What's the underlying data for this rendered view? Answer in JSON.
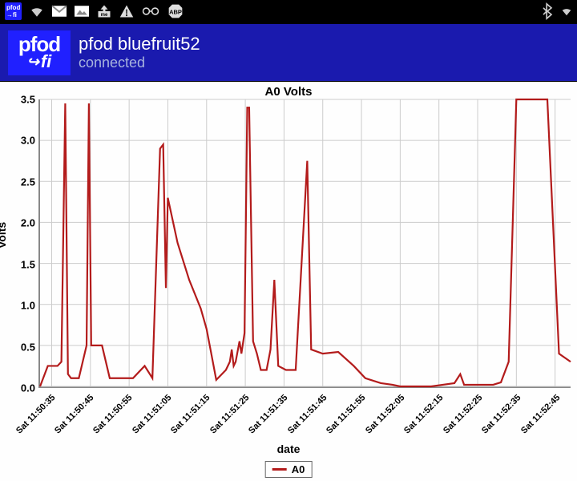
{
  "status_bar": {
    "left_icons": [
      "pfod-mini",
      "wifi",
      "gmail",
      "photos",
      "upload-me",
      "warning",
      "glasses",
      "abp"
    ],
    "right_icons": [
      "bluetooth",
      "wifi"
    ]
  },
  "header": {
    "logo": {
      "line1": "pfod",
      "line2": "fi"
    },
    "title": "pfod bluefruit52",
    "subtitle": "connected"
  },
  "chart_data": {
    "type": "line",
    "title": "A0 Volts",
    "ylabel": "Volts",
    "xlabel": "date",
    "ylim": [
      0.0,
      3.5
    ],
    "yticks": [
      0.0,
      0.5,
      1.0,
      1.5,
      2.0,
      2.5,
      3.0,
      3.5
    ],
    "categories": [
      "Sat 11:50:35",
      "Sat 11:50:45",
      "Sat 11:50:55",
      "Sat 11:51:05",
      "Sat 11:51:15",
      "Sat 11:51:25",
      "Sat 11:51:35",
      "Sat 11:51:45",
      "Sat 11:51:55",
      "Sat 11:52:05",
      "Sat 11:52:15",
      "Sat 11:52:25",
      "Sat 11:52:35",
      "Sat 11:52:45"
    ],
    "series": [
      {
        "name": "A0",
        "color": "#b31b1b",
        "points": [
          [
            -0.3,
            0.0
          ],
          [
            -0.1,
            0.25
          ],
          [
            0.15,
            0.25
          ],
          [
            0.25,
            0.3
          ],
          [
            0.35,
            3.45
          ],
          [
            0.42,
            0.15
          ],
          [
            0.5,
            0.1
          ],
          [
            0.7,
            0.1
          ],
          [
            0.9,
            0.5
          ],
          [
            0.96,
            3.45
          ],
          [
            1.02,
            0.5
          ],
          [
            1.3,
            0.5
          ],
          [
            1.5,
            0.1
          ],
          [
            1.8,
            0.1
          ],
          [
            2.1,
            0.1
          ],
          [
            2.4,
            0.25
          ],
          [
            2.6,
            0.1
          ],
          [
            2.8,
            2.9
          ],
          [
            2.88,
            2.95
          ],
          [
            2.95,
            1.2
          ],
          [
            3.0,
            2.3
          ],
          [
            3.25,
            1.75
          ],
          [
            3.55,
            1.3
          ],
          [
            3.85,
            0.95
          ],
          [
            4.0,
            0.7
          ],
          [
            4.1,
            0.45
          ],
          [
            4.25,
            0.08
          ],
          [
            4.5,
            0.2
          ],
          [
            4.6,
            0.3
          ],
          [
            4.65,
            0.45
          ],
          [
            4.7,
            0.25
          ],
          [
            4.75,
            0.3
          ],
          [
            4.85,
            0.55
          ],
          [
            4.9,
            0.4
          ],
          [
            4.98,
            0.65
          ],
          [
            5.05,
            3.4
          ],
          [
            5.1,
            3.4
          ],
          [
            5.2,
            0.55
          ],
          [
            5.3,
            0.4
          ],
          [
            5.4,
            0.2
          ],
          [
            5.55,
            0.2
          ],
          [
            5.65,
            0.45
          ],
          [
            5.75,
            1.3
          ],
          [
            5.85,
            0.25
          ],
          [
            6.05,
            0.2
          ],
          [
            6.3,
            0.2
          ],
          [
            6.6,
            2.75
          ],
          [
            6.7,
            0.45
          ],
          [
            7.0,
            0.4
          ],
          [
            7.4,
            0.42
          ],
          [
            7.8,
            0.25
          ],
          [
            8.1,
            0.1
          ],
          [
            8.5,
            0.04
          ],
          [
            8.8,
            0.02
          ],
          [
            9.0,
            0.0
          ],
          [
            9.4,
            0.0
          ],
          [
            9.8,
            0.0
          ],
          [
            10.1,
            0.02
          ],
          [
            10.4,
            0.04
          ],
          [
            10.55,
            0.15
          ],
          [
            10.65,
            0.02
          ],
          [
            10.8,
            0.02
          ],
          [
            11.2,
            0.02
          ],
          [
            11.4,
            0.02
          ],
          [
            11.6,
            0.05
          ],
          [
            11.8,
            0.3
          ],
          [
            12.0,
            3.5
          ],
          [
            12.1,
            3.5
          ],
          [
            12.3,
            3.5
          ],
          [
            12.6,
            3.5
          ],
          [
            12.8,
            3.5
          ],
          [
            13.1,
            0.4
          ],
          [
            13.4,
            0.3
          ]
        ]
      }
    ],
    "legend": {
      "label": "A0"
    }
  }
}
